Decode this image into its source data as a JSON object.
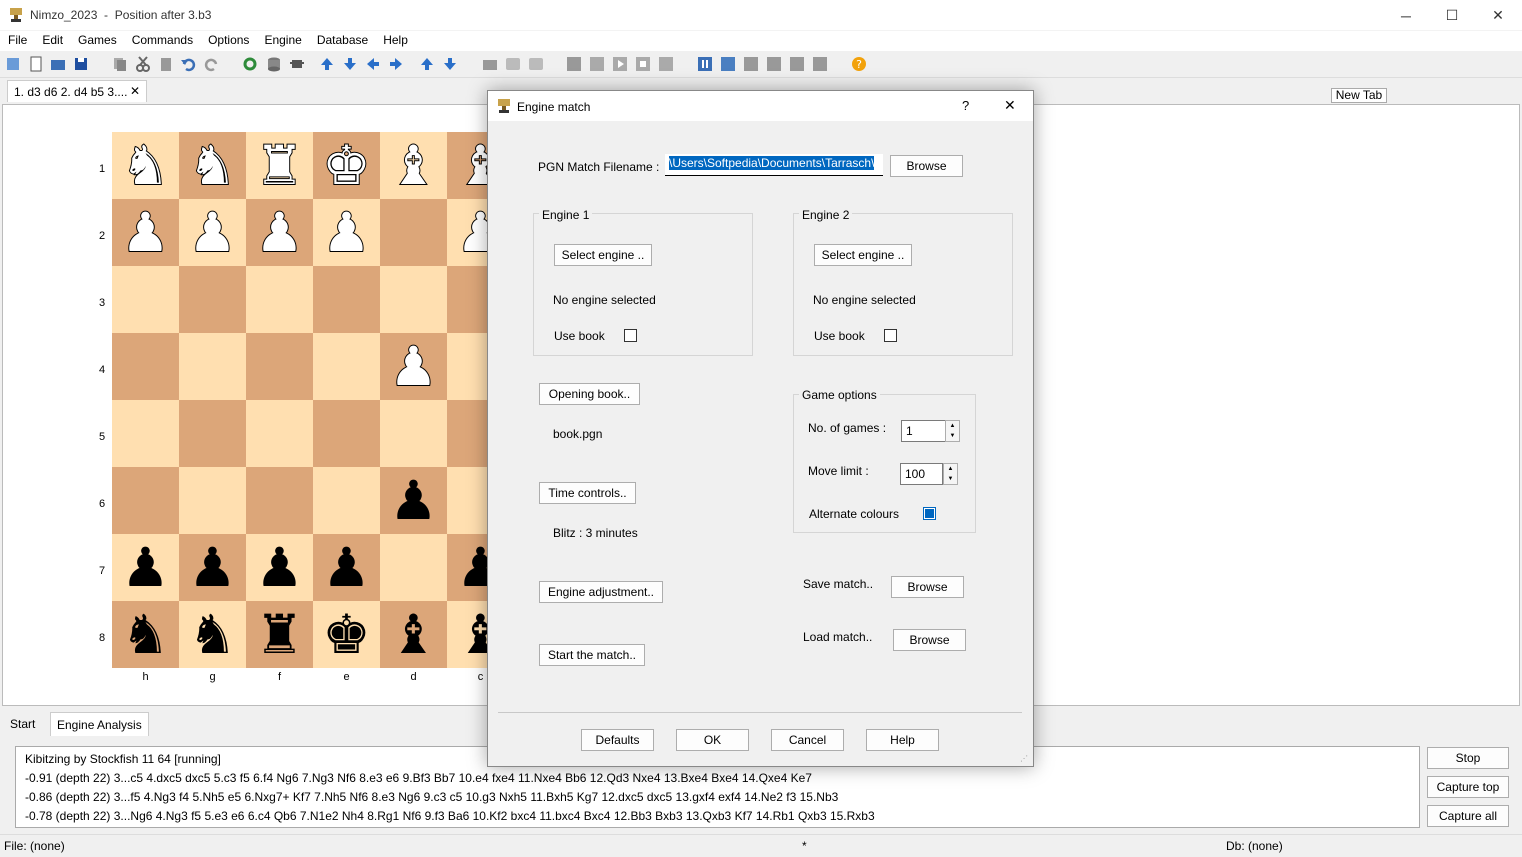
{
  "window": {
    "app_name": "Nimzo_2023",
    "separator": "-",
    "subtitle": "Position after 3.b3"
  },
  "menu": [
    "File",
    "Edit",
    "Games",
    "Commands",
    "Options",
    "Engine",
    "Database",
    "Help"
  ],
  "tabs": {
    "doc_tab": "1. d3 d6 2. d4 b5 3....",
    "close": "✕",
    "new_tab": "New Tab"
  },
  "board": {
    "ranks": [
      "1",
      "2",
      "3",
      "4",
      "5",
      "6",
      "7",
      "8"
    ],
    "files": [
      "h",
      "g",
      "f",
      "e",
      "d",
      "c"
    ]
  },
  "bottom_tabs": [
    "Start",
    "Engine Analysis"
  ],
  "analysis": {
    "lines": [
      "Kibitzing by Stockfish 11 64 [running]",
      "-0.91 (depth 22) 3...c5 4.dxc5 dxc5 5.c3 f5 6.f4 Ng6 7.Ng3 Nf6 8.e3 e6 9.Bf3 Bb7 10.e4 fxe4 11.Nxe4 Bb6 12.Qd3 Nxe4 13.Bxe4 Bxe4 14.Qxe4 Ke7",
      "-0.86 (depth 22) 3...f5 4.Ng3 f4 5.Nh5 e5 6.Nxg7+ Kf7 7.Nh5 Nf6 8.e3 Ng6 9.c3 c5 10.g3 Nxh5 11.Bxh5 Kg7 12.dxc5 dxc5 13.gxf4 exf4 14.Ne2 f3 15.Nb3",
      "-0.78 (depth 22) 3...Ng6 4.Ng3 f5 5.e3 e6 6.c4 Qb6 7.N1e2 Nh4 8.Rg1 Nf6 9.f3 Ba6 10.Kf2 bxc4 11.bxc4 Bxc4 12.Bb3 Bxb3 13.Qxb3 Kf7 14.Rb1 Qxb3 15.Rxb3"
    ],
    "buttons": {
      "stop": "Stop",
      "capture_top": "Capture top",
      "capture_all": "Capture all"
    }
  },
  "status": {
    "file": "File: (none)",
    "middle": "*",
    "db": "Db: (none)"
  },
  "dialog": {
    "title": "Engine match",
    "help_mark": "?",
    "close": "✕",
    "pgn_label": "PGN Match Filename :",
    "pgn_value": "\\Users\\Softpedia\\Documents\\Tarrasch\\",
    "browse": "Browse",
    "engine1": {
      "group": "Engine 1",
      "select": "Select engine ..",
      "status": "No engine selected",
      "use_book": "Use book",
      "use_book_checked": false
    },
    "engine2": {
      "group": "Engine 2",
      "select": "Select engine ..",
      "status": "No engine selected",
      "use_book": "Use book",
      "use_book_checked": false
    },
    "opening_book": "Opening book..",
    "book_file": "book.pgn",
    "time_controls": "Time controls..",
    "blitz": "Blitz :  3 minutes",
    "engine_adjustment": "Engine adjustment..",
    "start_match": "Start the match..",
    "game_options": {
      "group": "Game options",
      "games_label": "No. of games :",
      "games_value": "1",
      "move_limit_label": "Move limit :",
      "move_limit_value": "100",
      "alternate": "Alternate colours",
      "alternate_checked": true
    },
    "save_match": "Save match..",
    "load_match": "Load match..",
    "footer": {
      "defaults": "Defaults",
      "ok": "OK",
      "cancel": "Cancel",
      "help": "Help"
    }
  }
}
